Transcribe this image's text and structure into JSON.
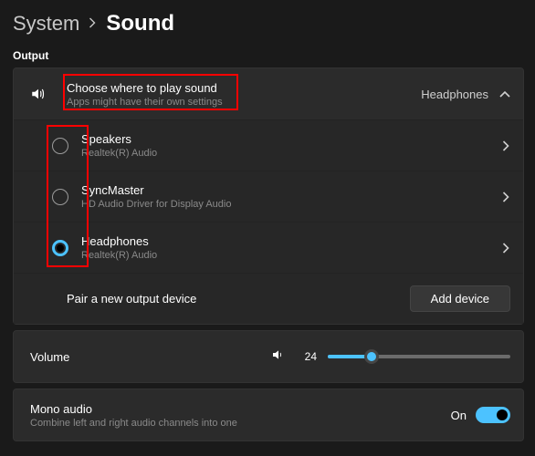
{
  "breadcrumb": {
    "prev": "System",
    "current": "Sound"
  },
  "section": {
    "output_label": "Output"
  },
  "output_group": {
    "title": "Choose where to play sound",
    "subtitle": "Apps might have their own settings",
    "current_device": "Headphones"
  },
  "devices": [
    {
      "name": "Speakers",
      "driver": "Realtek(R) Audio",
      "selected": false
    },
    {
      "name": "SyncMaster",
      "driver": "HD Audio Driver for Display Audio",
      "selected": false
    },
    {
      "name": "Headphones",
      "driver": "Realtek(R) Audio",
      "selected": true
    }
  ],
  "pair": {
    "label": "Pair a new output device",
    "button": "Add device"
  },
  "volume": {
    "label": "Volume",
    "value": "24",
    "percent": 24
  },
  "mono": {
    "title": "Mono audio",
    "subtitle": "Combine left and right audio channels into one",
    "state_label": "On",
    "on": true
  },
  "colors": {
    "accent": "#4cc2ff",
    "highlight": "#ff0000"
  }
}
